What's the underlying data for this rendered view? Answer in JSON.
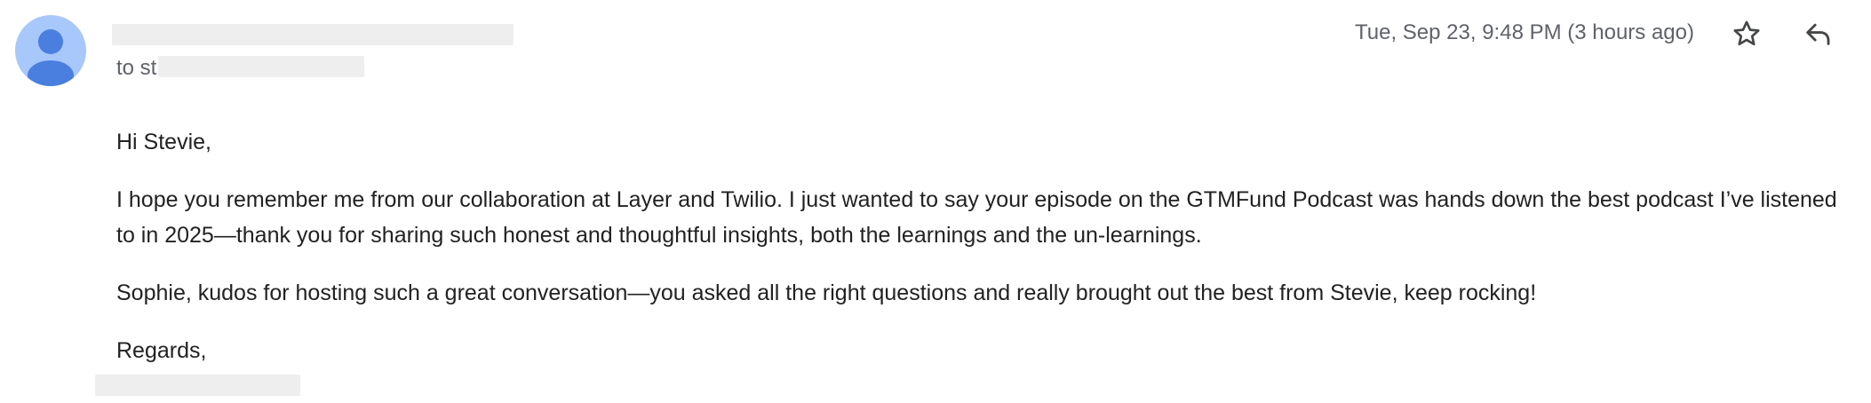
{
  "email": {
    "to_prefix": "to st",
    "timestamp": "Tue, Sep 23, 9:48 PM (3 hours ago)",
    "body": {
      "greeting": "Hi Stevie,",
      "paragraph1": "I hope you remember me from our collaboration at Layer and Twilio. I just wanted to say your episode on the GTMFund Podcast was hands down the best podcast I’ve listened to in 2025—thank you for sharing such honest and thoughtful insights, both the learnings and the un-learnings.",
      "paragraph2": "Sophie, kudos for hosting such a great conversation—you asked all the right questions and really brought out the best from Stevie, keep rocking!",
      "closing": "Regards,"
    }
  },
  "icons": {
    "avatar": "person-icon",
    "star": "star-icon",
    "reply": "reply-icon"
  },
  "colors": {
    "avatar_bg": "#a8c7fa",
    "avatar_figure": "#4a7fe0",
    "meta_text": "#5f6368",
    "body_text": "#222222",
    "redaction": "#eeeeee"
  }
}
